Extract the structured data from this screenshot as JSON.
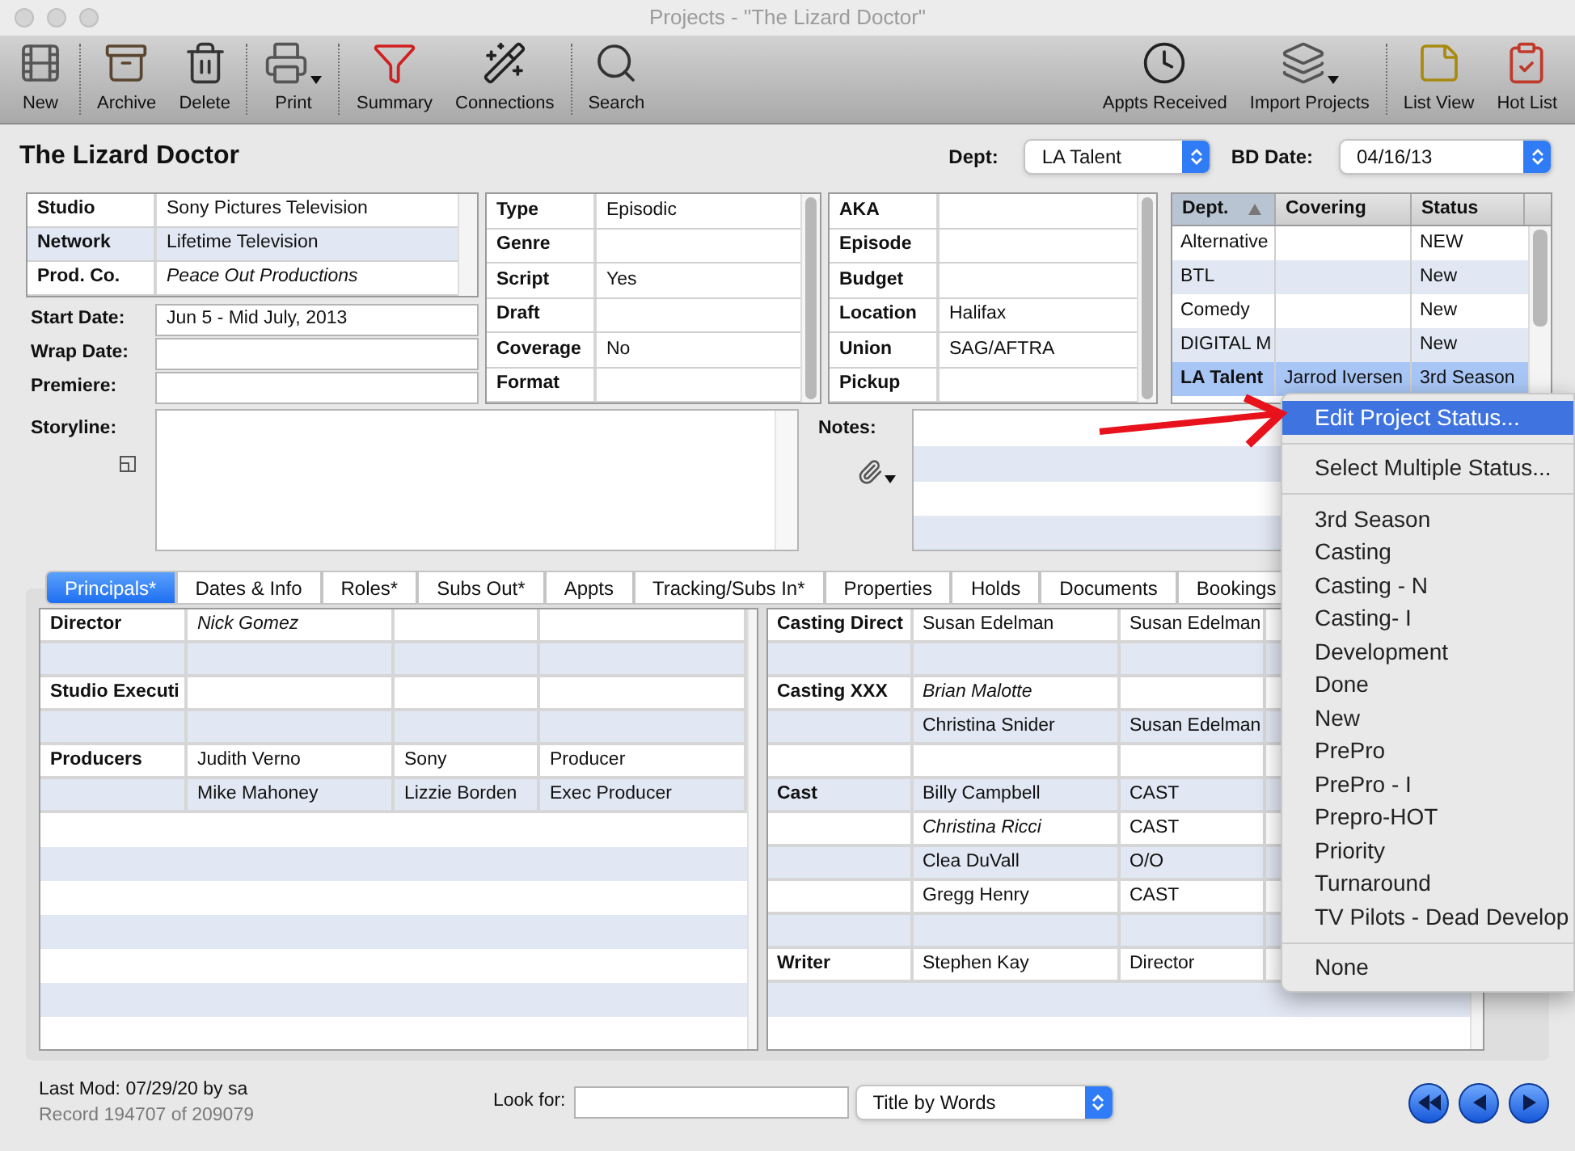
{
  "window": {
    "title": "Projects - \"The Lizard Doctor\""
  },
  "toolbar": {
    "left_groups": [
      [
        {
          "label": "New",
          "has_menu": false
        }
      ],
      [
        {
          "label": "Archive",
          "has_menu": false
        },
        {
          "label": "Delete",
          "has_menu": false
        }
      ],
      [
        {
          "label": "Print",
          "has_menu": true
        }
      ],
      [
        {
          "label": "Summary",
          "has_menu": false
        },
        {
          "label": "Connections",
          "has_menu": false
        }
      ],
      [
        {
          "label": "Search",
          "has_menu": false
        }
      ]
    ],
    "right_groups": [
      [
        {
          "label": "Appts Received",
          "has_menu": false
        },
        {
          "label": "Import Projects",
          "has_menu": true
        }
      ],
      [
        {
          "label": "List View",
          "has_menu": false
        },
        {
          "label": "Hot List",
          "has_menu": false
        }
      ]
    ]
  },
  "header": {
    "title": "The Lizard Doctor",
    "dept": {
      "label": "Dept:",
      "value": "LA Talent"
    },
    "bd_date": {
      "label": "BD Date:",
      "value": "04/16/13"
    }
  },
  "studio_table": [
    {
      "label": "Studio",
      "value": "Sony Pictures Television",
      "italic": false
    },
    {
      "label": "Network",
      "value": "Lifetime Television",
      "italic": false
    },
    {
      "label": "Prod. Co.",
      "value": "Peace Out Productions",
      "italic": true
    }
  ],
  "dates": [
    {
      "label": "Start Date:",
      "value": "Jun 5 - Mid July, 2013"
    },
    {
      "label": "Wrap Date:"
    },
    {
      "label": "Premiere:"
    }
  ],
  "type_table": [
    {
      "label": "Type",
      "value": "Episodic"
    },
    {
      "label": "Genre"
    },
    {
      "label": "Script",
      "value": "Yes"
    },
    {
      "label": "Draft"
    },
    {
      "label": "Coverage",
      "value": "No"
    },
    {
      "label": "Format"
    }
  ],
  "aka_table": [
    {
      "label": "AKA"
    },
    {
      "label": "Episode"
    },
    {
      "label": "Budget"
    },
    {
      "label": "Location",
      "value": "Halifax"
    },
    {
      "label": "Union",
      "value": "SAG/AFTRA"
    },
    {
      "label": "Pickup"
    }
  ],
  "dept_table": {
    "columns": [
      "Dept.",
      "Covering",
      "Status"
    ],
    "rows": [
      {
        "dept": "Alternative",
        "status": "NEW",
        "selected": false
      },
      {
        "dept": "BTL",
        "status": "New",
        "selected": false
      },
      {
        "dept": "Comedy",
        "status": "New",
        "selected": false
      },
      {
        "dept": "DIGITAL M",
        "status": "New",
        "selected": false
      },
      {
        "dept": "LA Talent",
        "covering": "Jarrod Iversen",
        "status": "3rd Season",
        "selected": true
      }
    ]
  },
  "storyline": {
    "label": "Storyline:"
  },
  "notes": {
    "label": "Notes:"
  },
  "tabs": [
    {
      "label": "Principals*",
      "selected": true
    },
    {
      "label": "Dates & Info",
      "selected": false
    },
    {
      "label": "Roles*",
      "selected": false
    },
    {
      "label": "Subs Out*",
      "selected": false
    },
    {
      "label": "Appts",
      "selected": false
    },
    {
      "label": "Tracking/Subs In*",
      "selected": false
    },
    {
      "label": "Properties",
      "selected": false
    },
    {
      "label": "Holds",
      "selected": false
    },
    {
      "label": "Documents",
      "selected": false
    },
    {
      "label": "Bookings",
      "selected": false
    }
  ],
  "principals": {
    "left_rows": [
      {
        "column_1": "Director",
        "column_2": "Nick  Gomez",
        "italic": true
      },
      {},
      {
        "column_1": "Studio Executi"
      },
      {},
      {
        "column_1": "Producers",
        "column_2": "Judith Verno",
        "column_3": "Sony",
        "column_4": "Producer",
        "italic": false
      },
      {
        "column_2": "Mike Mahoney",
        "column_3": "Lizzie Borden",
        "column_4": "Exec Producer",
        "italic": false
      }
    ],
    "right_rows": [
      {
        "column_1": "Casting Direct",
        "column_2": "Susan Edelman",
        "column_3": "Susan Edelman",
        "italic": false
      },
      {},
      {
        "column_1": "Casting XXX",
        "column_2": "Brian Malotte",
        "italic": true
      },
      {
        "column_2": "Christina Snider",
        "column_3": "Susan Edelman",
        "italic": false
      },
      {},
      {
        "column_1": "Cast",
        "column_2": "Billy Campbell",
        "column_3": "CAST",
        "italic": false
      },
      {
        "column_2": "Christina Ricci",
        "column_3": "CAST",
        "italic": true
      },
      {
        "column_2": "Clea DuVall",
        "column_3": "O/O",
        "italic": false
      },
      {
        "column_2": "Gregg Henry",
        "column_3": "CAST",
        "italic": false
      },
      {},
      {
        "column_1": "Writer",
        "column_2": "Stephen Kay",
        "column_3": "Director",
        "italic": false
      }
    ]
  },
  "menu": {
    "sections": [
      [
        {
          "label": "Edit Project Status...",
          "highlighted": true
        }
      ],
      [
        {
          "label": "Select Multiple Status...",
          "highlighted": false
        }
      ],
      [
        {
          "label": "3rd Season",
          "highlighted": false
        },
        {
          "label": "Casting",
          "highlighted": false
        },
        {
          "label": "Casting - N",
          "highlighted": false
        },
        {
          "label": "Casting- I",
          "highlighted": false
        },
        {
          "label": "Development",
          "highlighted": false
        },
        {
          "label": "Done",
          "highlighted": false
        },
        {
          "label": "New",
          "highlighted": false
        },
        {
          "label": "PrePro",
          "highlighted": false
        },
        {
          "label": "PrePro - I",
          "highlighted": false
        },
        {
          "label": "Prepro-HOT",
          "highlighted": false
        },
        {
          "label": "Priority",
          "highlighted": false
        },
        {
          "label": "Turnaround",
          "highlighted": false
        },
        {
          "label": "TV Pilots - Dead Develop",
          "highlighted": false
        }
      ],
      [
        {
          "label": "None",
          "highlighted": false
        }
      ]
    ]
  },
  "footer": {
    "last_mod": "Last Mod: 07/29/20 by sa",
    "record": "Record 194707 of 209079",
    "look_for_label": "Look for:",
    "search_mode": "Title by Words"
  }
}
